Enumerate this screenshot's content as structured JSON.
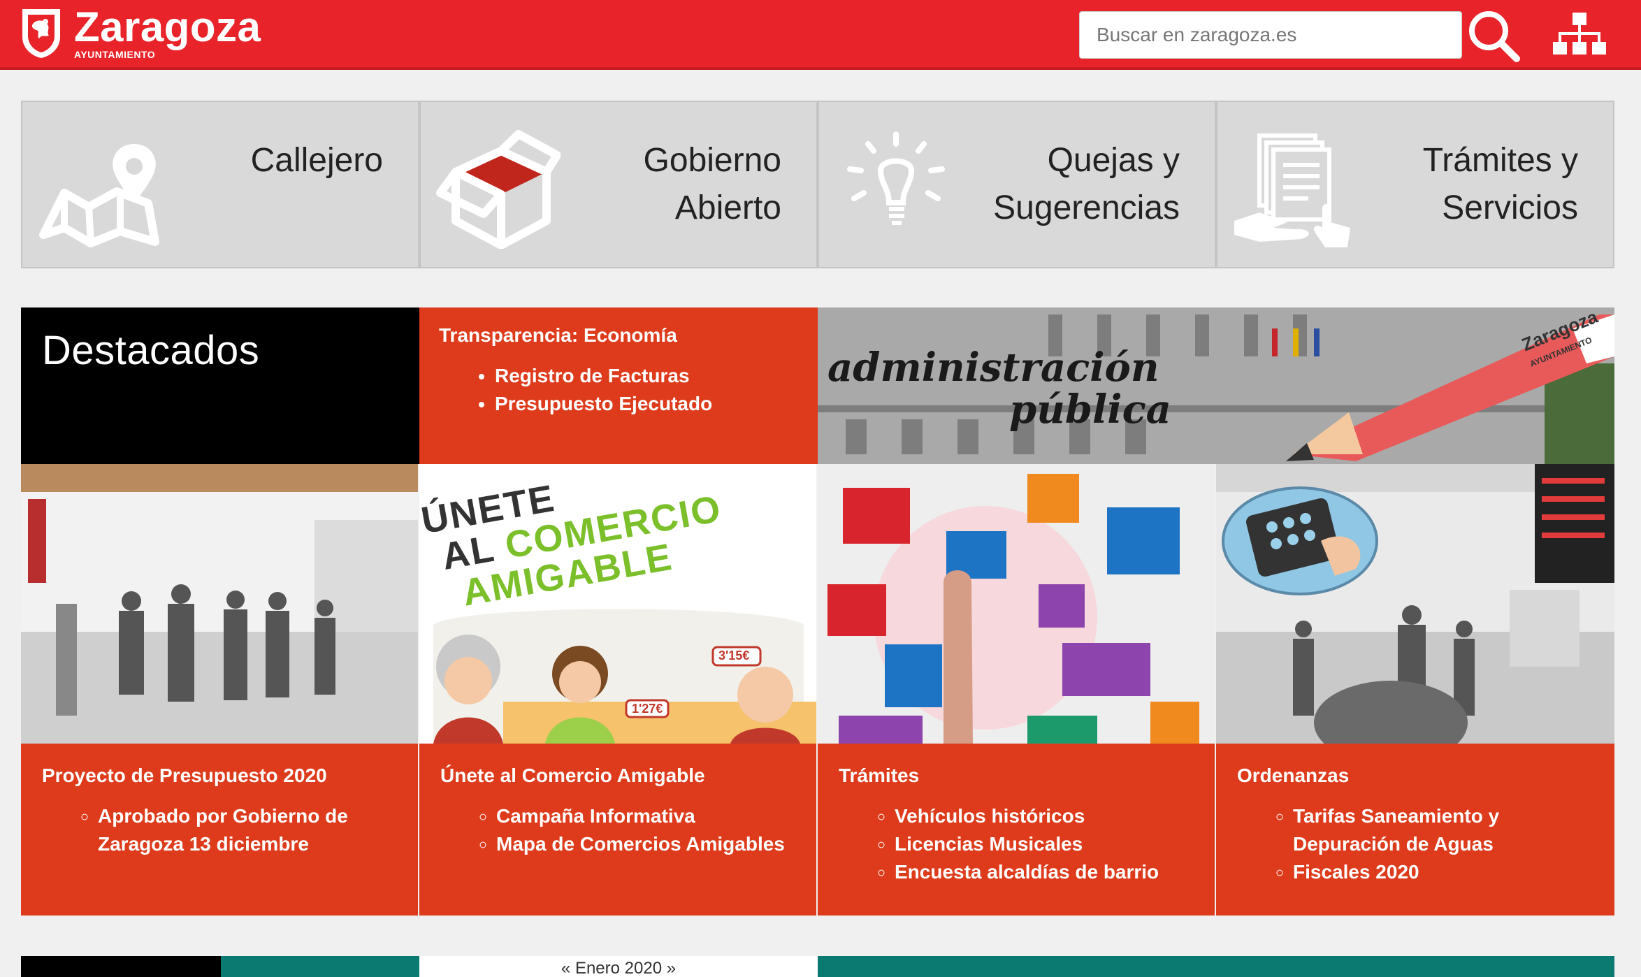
{
  "header": {
    "logo_name": "Zaragoza",
    "logo_sub": "AYUNTAMIENTO",
    "search_placeholder": "Buscar en zaragoza.es",
    "colors": {
      "brand": "#e8232a",
      "feature": "#dd3b1b",
      "teal": "#0b7b72"
    }
  },
  "tiles": [
    {
      "label": "Callejero",
      "icon": "map-pin-icon"
    },
    {
      "label": "Gobierno\nAbierto",
      "icon": "open-box-icon"
    },
    {
      "label": "Quejas y\nSugerencias",
      "icon": "lightbulb-icon"
    },
    {
      "label": "Trámites y\nServicios",
      "icon": "documents-hand-icon"
    }
  ],
  "featured": {
    "title": "Destacados",
    "transparency": {
      "heading": "Transparencia: Economía",
      "items": [
        "Registro de Facturas",
        "Presupuesto Ejecutado"
      ]
    },
    "banner": {
      "line1": "administración",
      "line2": "pública",
      "pencil_logo": "Zaragoza",
      "pencil_sub": "AYUNTAMIENTO"
    }
  },
  "cards": [
    {
      "heading": "Proyecto de Presupuesto 2020",
      "items": [
        "Aprobado por Gobierno de Zaragoza 13 diciembre"
      ]
    },
    {
      "heading": "Únete al Comercio Amigable",
      "items": [
        "Campaña Informativa",
        "Mapa de Comercios Amigables"
      ],
      "image_text": {
        "l1": "ÚNETE",
        "l2": "AL",
        "l3": "COMERCIO",
        "l4": "AMIGABLE",
        "price1": "3'15€",
        "price2": "1'27€"
      }
    },
    {
      "heading": "Trámites",
      "items": [
        "Vehículos históricos",
        "Licencias Musicales",
        "Encuesta alcaldías de barrio"
      ]
    },
    {
      "heading": "Ordenanzas",
      "items": [
        "Tarifas Saneamiento y Depuración de Aguas",
        "Fiscales 2020"
      ]
    }
  ],
  "calendar": {
    "month": "« Enero 2020 »"
  }
}
